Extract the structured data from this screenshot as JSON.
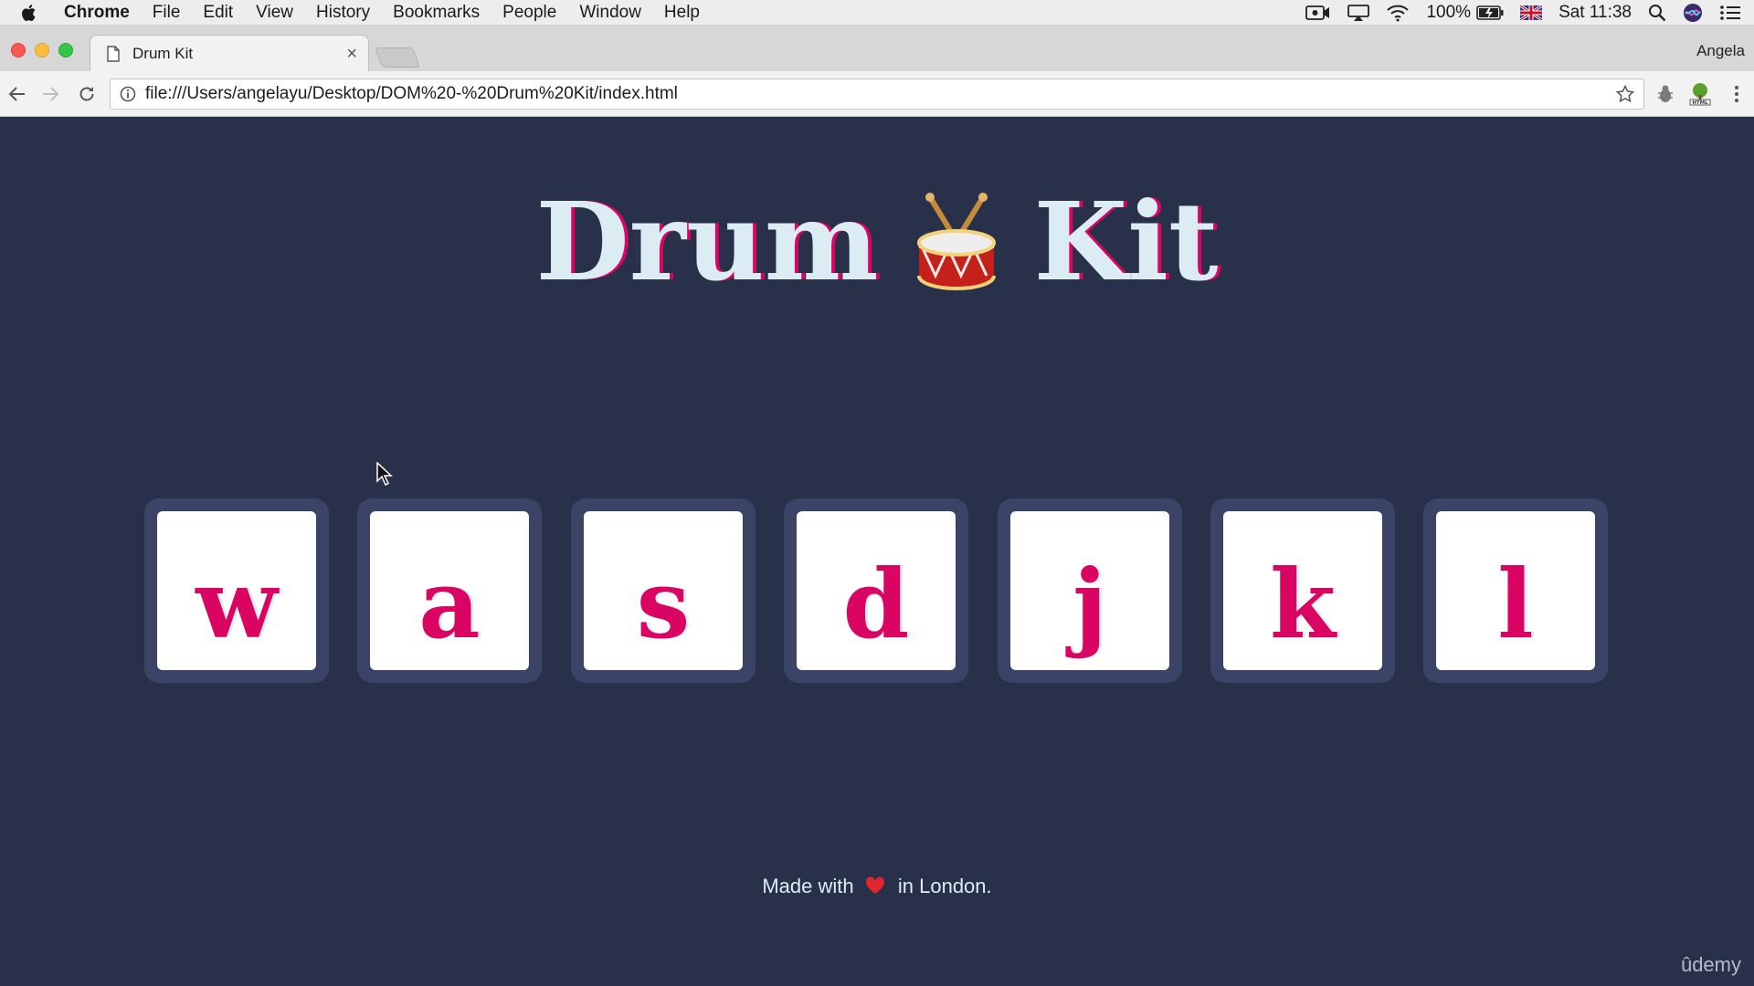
{
  "os_menubar": {
    "app_name": "Chrome",
    "menus": [
      "File",
      "Edit",
      "View",
      "History",
      "Bookmarks",
      "People",
      "Window",
      "Help"
    ],
    "battery": "100%",
    "clock": "Sat 11:38"
  },
  "browser": {
    "tab_title": "Drum Kit",
    "tab_close": "×",
    "profile_name": "Angela",
    "url": "file:///Users/angelayu/Desktop/DOM%20-%20Drum%20Kit/index.html"
  },
  "page": {
    "title_word1": "Drum",
    "title_word2": "Kit",
    "drums": [
      {
        "key": "w"
      },
      {
        "key": "a"
      },
      {
        "key": "s"
      },
      {
        "key": "d"
      },
      {
        "key": "j"
      },
      {
        "key": "k"
      },
      {
        "key": "l"
      }
    ],
    "footer_before": "Made with",
    "footer_after": "in London.",
    "colors": {
      "background": "#283149",
      "accent": "#da0463",
      "text": "#dbedf3"
    }
  },
  "watermark": "ûdemy"
}
